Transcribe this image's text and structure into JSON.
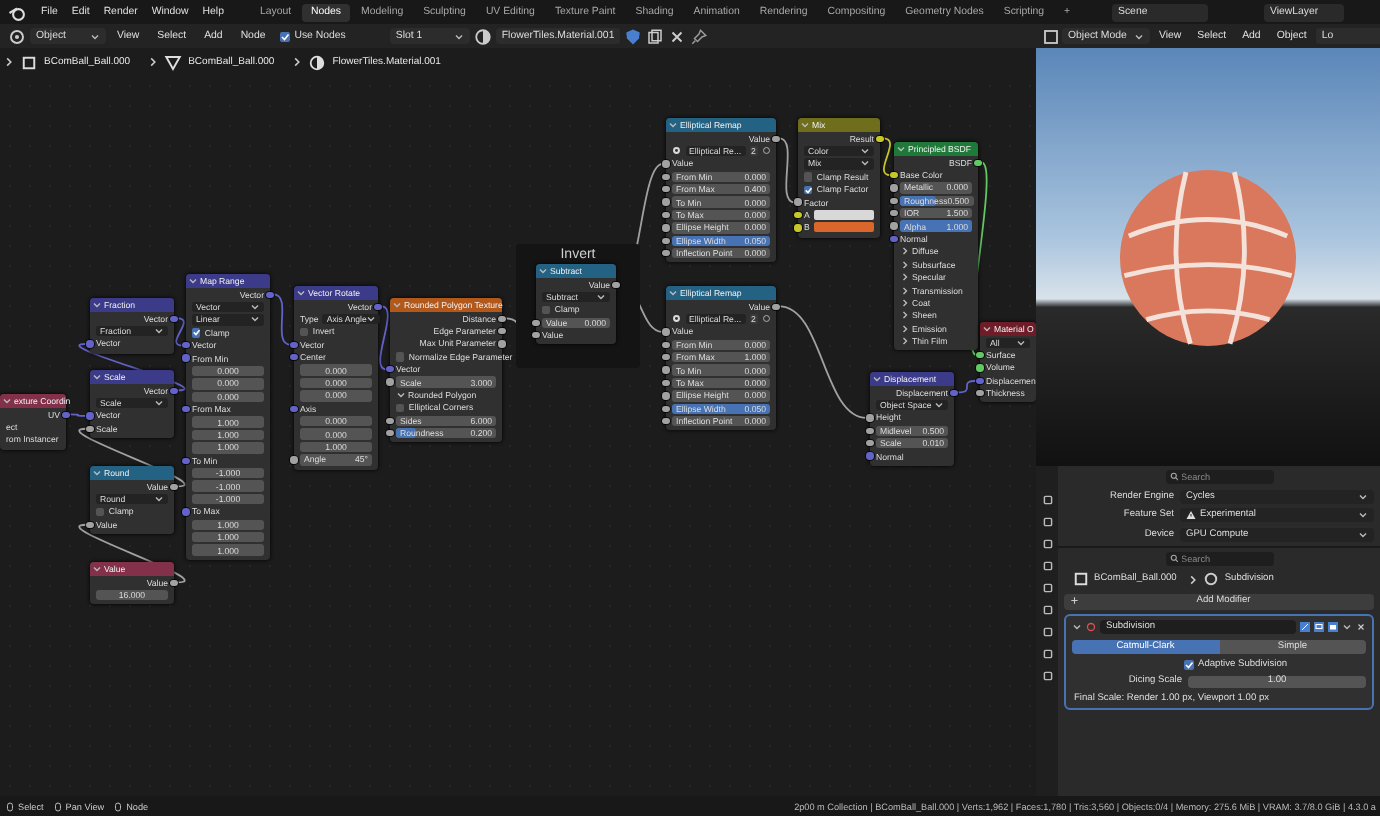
{
  "top_bar": {
    "menus": [
      "File",
      "Edit",
      "Render",
      "Window",
      "Help"
    ],
    "workspaces": [
      {
        "label": "Layout",
        "selected": false
      },
      {
        "label": "Nodes",
        "selected": true
      },
      {
        "label": "Modeling",
        "selected": false
      },
      {
        "label": "Sculpting",
        "selected": false
      },
      {
        "label": "UV Editing",
        "selected": false
      },
      {
        "label": "Texture Paint",
        "selected": false
      },
      {
        "label": "Shading",
        "selected": false
      },
      {
        "label": "Animation",
        "selected": false
      },
      {
        "label": "Rendering",
        "selected": false
      },
      {
        "label": "Compositing",
        "selected": false
      },
      {
        "label": "Geometry Nodes",
        "selected": false
      },
      {
        "label": "Scripting",
        "selected": false
      }
    ],
    "add_workspace": "+",
    "scene": "Scene",
    "view_layer": "ViewLayer"
  },
  "node_editor": {
    "header": {
      "object_mode": "Object",
      "menus": [
        "View",
        "Select",
        "Add",
        "Node"
      ],
      "use_nodes": {
        "label": "Use Nodes",
        "checked": true
      },
      "slot": "Slot 1",
      "material": "FlowerTiles.Material.001"
    },
    "breadcrumbs": [
      "BComBall_Ball.000",
      "BComBall_Ball.000",
      "FlowerTiles.Material.001"
    ],
    "frame_label": "Invert",
    "nodes": [
      {
        "kind": "input",
        "title": "exture Coordin",
        "rows": [
          {
            "kind": "output",
            "label": "UV",
            "socket": {
              "color": "#6363c7"
            }
          },
          {
            "kind": "label",
            "label": "ect"
          },
          {
            "kind": "label",
            "label": "rom Instancer"
          }
        ]
      },
      {
        "kind": "vector",
        "title": "Fraction",
        "rows": [
          {
            "kind": "output",
            "label": "Vector",
            "socket": {
              "color": "#6363c7"
            }
          },
          {
            "kind": "dropdown",
            "value": "Fraction"
          },
          {
            "kind": "input",
            "label": "Vector",
            "socket": {
              "color": "#6363c7"
            }
          }
        ]
      },
      {
        "kind": "vector",
        "title": "Scale",
        "rows": [
          {
            "kind": "output",
            "label": "Vector",
            "socket": {
              "color": "#6363c7"
            }
          },
          {
            "kind": "dropdown",
            "value": "Scale"
          },
          {
            "kind": "input",
            "label": "Vector",
            "socket": {
              "color": "#6363c7"
            }
          },
          {
            "kind": "input",
            "label": "Scale",
            "socket": {
              "color": "#a1a1a1"
            }
          }
        ]
      },
      {
        "kind": "converter",
        "title": "Round",
        "rows": [
          {
            "kind": "output",
            "label": "Value",
            "socket": {
              "color": "#a1a1a1"
            }
          },
          {
            "kind": "dropdown",
            "value": "Round"
          },
          {
            "kind": "checkbox",
            "label": "Clamp",
            "checked": false
          },
          {
            "kind": "input",
            "label": "Value",
            "socket": {
              "color": "#a1a1a1"
            }
          }
        ]
      },
      {
        "kind": "input",
        "title": "Value",
        "rows": [
          {
            "kind": "output",
            "label": "Value",
            "socket": {
              "color": "#a1a1a1"
            }
          },
          {
            "kind": "field",
            "value": "16.000"
          }
        ]
      },
      {
        "kind": "vector",
        "title": "Map Range",
        "rows": [
          {
            "kind": "output",
            "label": "Vector",
            "socket": {
              "color": "#6363c7"
            }
          },
          {
            "kind": "dropdown",
            "value": "Vector"
          },
          {
            "kind": "dropdown",
            "value": "Linear"
          },
          {
            "kind": "checkbox",
            "label": "Clamp",
            "checked": true
          },
          {
            "kind": "input",
            "label": "Vector",
            "socket": {
              "color": "#6363c7"
            }
          },
          {
            "kind": "input",
            "label": "From Min",
            "socket": {
              "color": "#6363c7"
            }
          },
          {
            "kind": "field",
            "value": "0.000"
          },
          {
            "kind": "field",
            "value": "0.000"
          },
          {
            "kind": "field",
            "value": "0.000"
          },
          {
            "kind": "input",
            "label": "From Max",
            "socket": {
              "color": "#6363c7"
            }
          },
          {
            "kind": "field",
            "value": "1.000"
          },
          {
            "kind": "field",
            "value": "1.000"
          },
          {
            "kind": "field",
            "value": "1.000"
          },
          {
            "kind": "input",
            "label": "To Min",
            "socket": {
              "color": "#6363c7"
            }
          },
          {
            "kind": "field",
            "value": "-1.000"
          },
          {
            "kind": "field",
            "value": "-1.000"
          },
          {
            "kind": "field",
            "value": "-1.000"
          },
          {
            "kind": "input",
            "label": "To Max",
            "socket": {
              "color": "#6363c7"
            }
          },
          {
            "kind": "field",
            "value": "1.000"
          },
          {
            "kind": "field",
            "value": "1.000"
          },
          {
            "kind": "field",
            "value": "1.000"
          }
        ]
      },
      {
        "kind": "vector",
        "title": "Vector Rotate",
        "rows": [
          {
            "kind": "output",
            "label": "Vector",
            "socket": {
              "color": "#6363c7"
            }
          },
          {
            "kind": "dropdown",
            "label": "Type",
            "value": "Axis Angle"
          },
          {
            "kind": "checkbox",
            "label": "Invert",
            "checked": false
          },
          {
            "kind": "input",
            "label": "Vector",
            "socket": {
              "color": "#6363c7"
            }
          },
          {
            "kind": "input",
            "label": "Center",
            "socket": {
              "color": "#6363c7"
            }
          },
          {
            "kind": "field",
            "value": "0.000"
          },
          {
            "kind": "field",
            "value": "0.000"
          },
          {
            "kind": "field",
            "value": "0.000"
          },
          {
            "kind": "input",
            "label": "Axis",
            "socket": {
              "color": "#6363c7"
            }
          },
          {
            "kind": "field",
            "value": "0.000"
          },
          {
            "kind": "field",
            "value": "0.000"
          },
          {
            "kind": "field",
            "value": "1.000"
          },
          {
            "kind": "field",
            "label": "Angle",
            "value": "45°",
            "socket": {
              "color": "#a1a1a1"
            }
          }
        ]
      },
      {
        "kind": "texture",
        "title": "Rounded Polygon Texture",
        "rows": [
          {
            "kind": "output",
            "label": "Distance",
            "socket": {
              "color": "#a1a1a1"
            }
          },
          {
            "kind": "output",
            "label": "Edge Parameter",
            "socket": {
              "color": "#a1a1a1"
            }
          },
          {
            "kind": "output",
            "label": "Max Unit Parameter",
            "socket": {
              "color": "#a1a1a1"
            }
          },
          {
            "kind": "checkbox",
            "label": "Normalize Edge Parameter",
            "checked": false
          },
          {
            "kind": "input",
            "label": "Vector",
            "socket": {
              "color": "#6363c7"
            }
          },
          {
            "kind": "field",
            "label": "Scale",
            "value": "3.000",
            "socket": {
              "color": "#a1a1a1"
            }
          },
          {
            "kind": "panel",
            "label": "Rounded Polygon",
            "expanded": true
          },
          {
            "kind": "checkbox",
            "label": "Elliptical Corners",
            "checked": false
          },
          {
            "kind": "field",
            "label": "Sides",
            "value": "6.000",
            "socket": {
              "color": "#a1a1a1"
            }
          },
          {
            "kind": "field",
            "label": "Roundness",
            "value": "0.200",
            "socket": {
              "color": "#a1a1a1"
            },
            "level": 0.2
          }
        ]
      },
      {
        "kind": "converter",
        "title": "Subtract",
        "rows": [
          {
            "kind": "output",
            "label": "Value",
            "socket": {
              "color": "#a1a1a1"
            }
          },
          {
            "kind": "dropdown",
            "value": "Subtract"
          },
          {
            "kind": "checkbox",
            "label": "Clamp",
            "checked": false
          },
          {
            "kind": "field",
            "label": "Value",
            "value": "0.000",
            "socket": {
              "color": "#a1a1a1"
            }
          },
          {
            "kind": "input",
            "label": "Value",
            "socket": {
              "color": "#a1a1a1"
            }
          }
        ]
      },
      {
        "kind": "converter",
        "title": "Elliptical Remap",
        "rows": [
          {
            "kind": "output",
            "label": "Value",
            "socket": {
              "color": "#a1a1a1"
            }
          },
          {
            "kind": "datablock",
            "value": "Elliptical Re...",
            "users": "2"
          },
          {
            "kind": "input",
            "label": "Value",
            "socket": {
              "color": "#a1a1a1"
            }
          },
          {
            "kind": "field",
            "label": "From Min",
            "value": "0.000",
            "socket": {
              "color": "#a1a1a1"
            }
          },
          {
            "kind": "field",
            "label": "From Max",
            "value": "0.400",
            "socket": {
              "color": "#a1a1a1"
            }
          },
          {
            "kind": "field",
            "label": "To Min",
            "value": "0.000",
            "socket": {
              "color": "#a1a1a1"
            }
          },
          {
            "kind": "field",
            "label": "To Max",
            "value": "0.000",
            "socket": {
              "color": "#a1a1a1"
            }
          },
          {
            "kind": "field",
            "label": "Ellipse Height",
            "value": "0.000",
            "socket": {
              "color": "#a1a1a1"
            }
          },
          {
            "kind": "field",
            "label": "Ellipse Width",
            "value": "0.050",
            "socket": {
              "color": "#a1a1a1"
            },
            "active": true
          },
          {
            "kind": "field",
            "label": "Inflection Point",
            "value": "0.000",
            "socket": {
              "color": "#a1a1a1"
            }
          }
        ]
      },
      {
        "kind": "converter",
        "title": "Elliptical Remap",
        "rows": [
          {
            "kind": "output",
            "label": "Value",
            "socket": {
              "color": "#a1a1a1"
            }
          },
          {
            "kind": "datablock",
            "value": "Elliptical Re...",
            "users": "2"
          },
          {
            "kind": "input",
            "label": "Value",
            "socket": {
              "color": "#a1a1a1"
            }
          },
          {
            "kind": "field",
            "label": "From Min",
            "value": "0.000",
            "socket": {
              "color": "#a1a1a1"
            }
          },
          {
            "kind": "field",
            "label": "From Max",
            "value": "1.000",
            "socket": {
              "color": "#a1a1a1"
            }
          },
          {
            "kind": "field",
            "label": "To Min",
            "value": "0.000",
            "socket": {
              "color": "#a1a1a1"
            }
          },
          {
            "kind": "field",
            "label": "To Max",
            "value": "0.000",
            "socket": {
              "color": "#a1a1a1"
            }
          },
          {
            "kind": "field",
            "label": "Ellipse Height",
            "value": "0.000",
            "socket": {
              "color": "#a1a1a1"
            }
          },
          {
            "kind": "field",
            "label": "Ellipse Width",
            "value": "0.050",
            "socket": {
              "color": "#a1a1a1"
            },
            "active": true
          },
          {
            "kind": "field",
            "label": "Inflection Point",
            "value": "0.000",
            "socket": {
              "color": "#a1a1a1"
            }
          }
        ]
      },
      {
        "kind": "color",
        "title": "Mix",
        "rows": [
          {
            "kind": "output",
            "label": "Result",
            "socket": {
              "color": "#c7c729"
            }
          },
          {
            "kind": "dropdown",
            "value": "Color"
          },
          {
            "kind": "dropdown",
            "value": "Mix"
          },
          {
            "kind": "checkbox",
            "label": "Clamp Result",
            "checked": false
          },
          {
            "kind": "checkbox",
            "label": "Clamp Factor",
            "checked": true
          },
          {
            "kind": "input",
            "label": "Factor",
            "socket": {
              "color": "#a1a1a1"
            }
          },
          {
            "kind": "swatch",
            "label": "A",
            "color": "#d8d8d8",
            "socket": {
              "color": "#c7c729"
            }
          },
          {
            "kind": "swatch",
            "label": "B",
            "color": "#d9662a",
            "socket": {
              "color": "#c7c729"
            }
          }
        ]
      },
      {
        "kind": "shader",
        "title": "Principled BSDF",
        "rows": [
          {
            "kind": "output",
            "label": "BSDF",
            "socket": {
              "color": "#63c763"
            }
          },
          {
            "kind": "input",
            "label": "Base Color",
            "socket": {
              "color": "#c7c729"
            }
          },
          {
            "kind": "field",
            "label": "Metallic",
            "value": "0.000",
            "socket": {
              "color": "#a1a1a1"
            }
          },
          {
            "kind": "field",
            "label": "Roughness",
            "value": "0.500",
            "socket": {
              "color": "#a1a1a1"
            },
            "level": 0.5
          },
          {
            "kind": "field",
            "label": "IOR",
            "value": "1.500",
            "socket": {
              "color": "#a1a1a1"
            }
          },
          {
            "kind": "field",
            "label": "Alpha",
            "value": "1.000",
            "socket": {
              "color": "#a1a1a1"
            },
            "level": 1
          },
          {
            "kind": "input",
            "label": "Normal",
            "socket": {
              "color": "#6363c7"
            }
          },
          {
            "kind": "panel",
            "label": "Diffuse",
            "expanded": false
          },
          {
            "kind": "panel",
            "label": "Subsurface",
            "expanded": false
          },
          {
            "kind": "panel",
            "label": "Specular",
            "expanded": false
          },
          {
            "kind": "panel",
            "label": "Transmission",
            "expanded": false
          },
          {
            "kind": "panel",
            "label": "Coat",
            "expanded": false
          },
          {
            "kind": "panel",
            "label": "Sheen",
            "expanded": false
          },
          {
            "kind": "panel",
            "label": "Emission",
            "expanded": false
          },
          {
            "kind": "panel",
            "label": "Thin Film",
            "expanded": false
          }
        ]
      },
      {
        "kind": "output",
        "title": "Material O",
        "rows": [
          {
            "kind": "dropdown",
            "value": "All"
          },
          {
            "kind": "input",
            "label": "Surface",
            "socket": {
              "color": "#63c763"
            }
          },
          {
            "kind": "input",
            "label": "Volume",
            "socket": {
              "color": "#63c763"
            }
          },
          {
            "kind": "input",
            "label": "Displacemen",
            "socket": {
              "color": "#6363c7"
            }
          },
          {
            "kind": "input",
            "label": "Thickness",
            "socket": {
              "color": "#a1a1a1"
            }
          }
        ]
      },
      {
        "kind": "vector",
        "title": "Displacement",
        "rows": [
          {
            "kind": "output",
            "label": "Displacement",
            "socket": {
              "color": "#6363c7"
            }
          },
          {
            "kind": "dropdown",
            "value": "Object Space"
          },
          {
            "kind": "input",
            "label": "Height",
            "socket": {
              "color": "#a1a1a1"
            }
          },
          {
            "kind": "field",
            "label": "Midlevel",
            "value": "0.500",
            "socket": {
              "color": "#a1a1a1"
            }
          },
          {
            "kind": "field",
            "label": "Scale",
            "value": "0.010",
            "socket": {
              "color": "#a1a1a1"
            }
          },
          {
            "kind": "input",
            "label": "Normal",
            "socket": {
              "color": "#6363c7"
            }
          }
        ]
      }
    ]
  },
  "viewport": {
    "mode": "Object Mode",
    "menus": [
      "View",
      "Select",
      "Add",
      "Object"
    ],
    "cut_label": "Lo"
  },
  "properties": {
    "render": {
      "search": {
        "placeholder": "Search"
      },
      "rows": [
        {
          "kind": "dropdown",
          "label": "Render Engine",
          "value": "Cycles"
        },
        {
          "kind": "warning",
          "label": "Feature Set",
          "value": "Experimental"
        },
        {
          "kind": "dropdown",
          "label": "Device",
          "value": "GPU Compute"
        }
      ]
    },
    "modifiers": {
      "search": {
        "placeholder": "Search"
      },
      "object": "BComBall_Ball.000",
      "modifier": "Subdivision",
      "add_button": "Add Modifier",
      "name": "Subdivision",
      "modes": [
        {
          "label": "Catmull-Clark",
          "selected": true
        },
        {
          "label": "Simple",
          "selected": false
        }
      ],
      "adaptive": {
        "label": "Adaptive Subdivision",
        "checked": true
      },
      "dicing": {
        "label": "Dicing Scale",
        "value": "1.00"
      },
      "final_scale": "Final Scale: Render 1.00 px, Viewport 1.00 px"
    }
  },
  "status_bar": {
    "hints": [
      "Select",
      "Pan View",
      "Node"
    ],
    "stats": "2p00 m Collection | BComBall_Ball.000 | Verts:1,962 | Faces:1,780 | Tris:3,560 | Objects:0/4 | Memory: 275.6 MiB | VRAM: 3.7/8.0 GiB | 4.3.0 a"
  }
}
